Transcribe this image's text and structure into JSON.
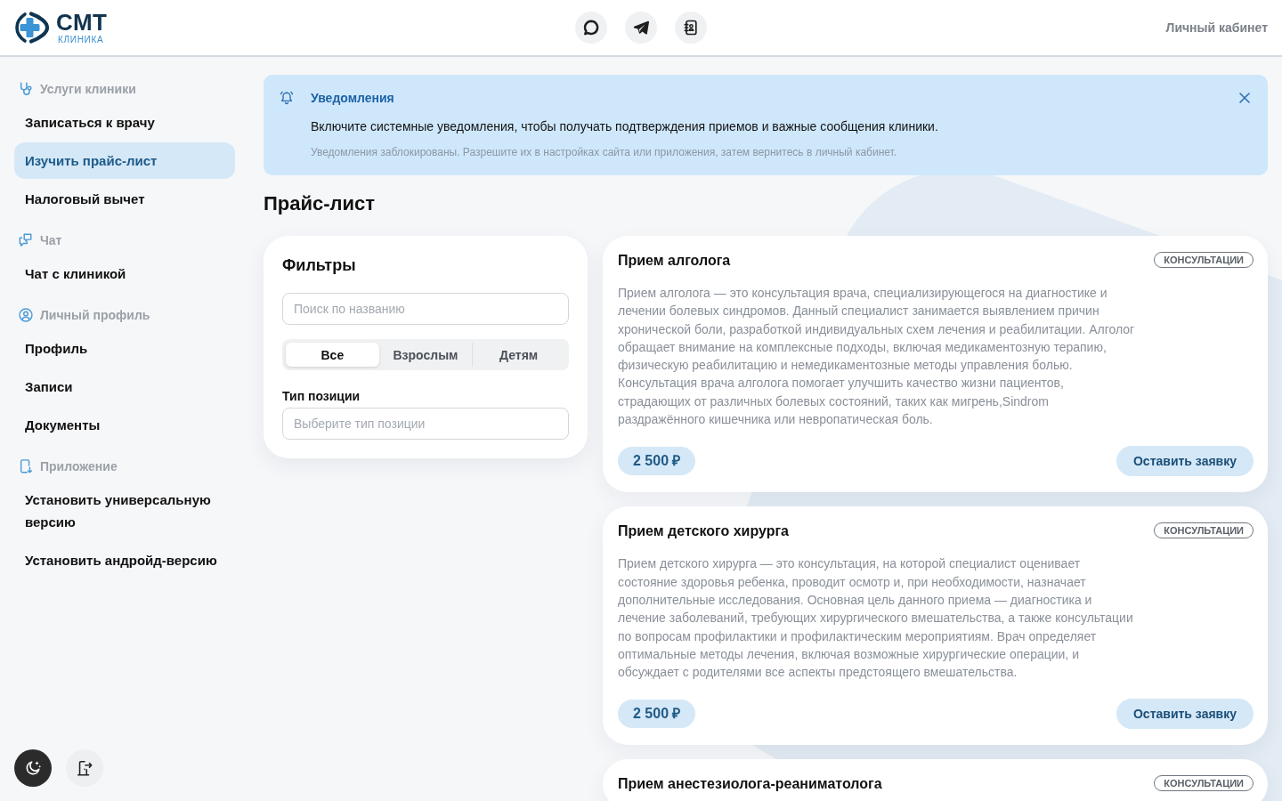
{
  "header": {
    "brand": {
      "name": "СМТ",
      "subtitle": "КЛИНИКА"
    },
    "account_link": "Личный кабинет"
  },
  "sidebar": {
    "sections": [
      {
        "title": "Услуги клиники",
        "items": [
          {
            "label": "Записаться к врачу",
            "selected": false
          },
          {
            "label": "Изучить прайс-лист",
            "selected": true
          },
          {
            "label": "Налоговый вычет",
            "selected": false
          }
        ]
      },
      {
        "title": "Чат",
        "items": [
          {
            "label": "Чат с клиникой",
            "selected": false
          }
        ]
      },
      {
        "title": "Личный профиль",
        "items": [
          {
            "label": "Профиль",
            "selected": false
          },
          {
            "label": "Записи",
            "selected": false
          },
          {
            "label": "Документы",
            "selected": false
          }
        ]
      },
      {
        "title": "Приложение",
        "items": [
          {
            "label": "Установить универсальную версию",
            "selected": false
          },
          {
            "label": "Установить андройд-версию",
            "selected": false
          }
        ]
      }
    ]
  },
  "notification": {
    "title": "Уведомления",
    "message": "Включите системные уведомления, чтобы получать подтверждения приемов и важные сообщения клиники.",
    "hint": "Уведомления заблокированы. Разрешите их в настройках сайта или приложения, затем вернитесь в личный кабинет."
  },
  "page_title": "Прайс-лист",
  "filters": {
    "title": "Фильтры",
    "search": {
      "placeholder": "Поиск по названию"
    },
    "audience": [
      {
        "label": "Все",
        "selected": true
      },
      {
        "label": "Взрослым",
        "selected": false
      },
      {
        "label": "Детям",
        "selected": false
      }
    ],
    "type": {
      "label": "Тип позиции",
      "placeholder": "Выберите тип позиции"
    }
  },
  "services": [
    {
      "title": "Прием алголога",
      "tag": "КОНСУЛЬТАЦИИ",
      "description": "Прием алголога — это консультация врача, специализирующегося на диагностике и лечении болевых синдромов. Данный специалист занимается выявлением причин хронической боли, разработкой индивидуальных схем лечения и реабилитации. Алголог обращает внимание на комплексные подходы, включая медикаментозную терапию, физическую реабилитацию и немедикаментозные методы управления болью.\nКонсультация врача алголога помогает улучшить качество жизни пациентов, страдающих от различных болевых состояний, таких как мигрень,Sindrom раздражённого кишечника или невропатическая боль.",
      "price": "2 500 ₽",
      "button": "Оставить заявку"
    },
    {
      "title": "Прием детского хирурга",
      "tag": "КОНСУЛЬТАЦИИ",
      "description": "Прием детского хирурга — это консультация, на которой специалист оценивает состояние здоровья ребенка, проводит осмотр и, при необходимости, назначает дополнительные исследования. Основная цель данного приема — диагностика и лечение заболеваний, требующих хирургического вмешательства, а также консультации по вопросам профилактики и профилактическим мероприятиям. Врач определяет оптимальные методы лечения, включая возможные хирургические операции, и обсуждает с родителями все аспекты предстоящего вмешательства.",
      "price": "2 500 ₽",
      "button": "Оставить заявку"
    },
    {
      "title": "Прием анестезиолога-реаниматолога",
      "tag": "КОНСУЛЬТАЦИИ"
    }
  ]
}
